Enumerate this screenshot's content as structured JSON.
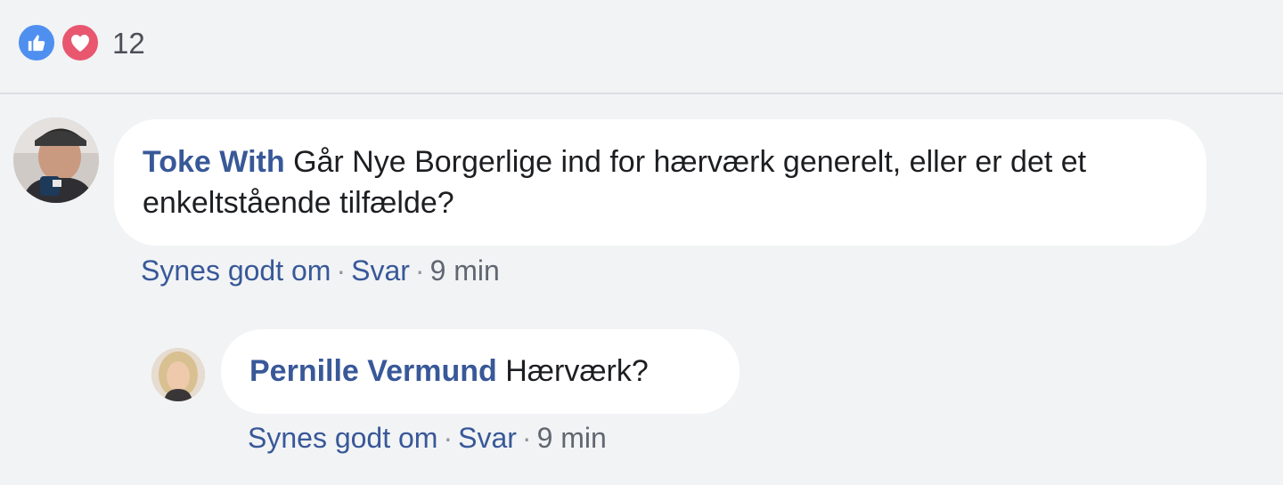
{
  "reactions": {
    "icons": [
      "like-icon",
      "love-icon"
    ],
    "count": "12"
  },
  "comments": [
    {
      "author": "Toke With",
      "text": "Går Nye Borgerlige ind for hærværk generelt, eller er det et enkeltstående tilfælde?",
      "actions": {
        "like": "Synes godt om",
        "reply": "Svar",
        "time": "9 min"
      }
    },
    {
      "author": "Pernille Vermund",
      "text": "Hærværk?",
      "actions": {
        "like": "Synes godt om",
        "reply": "Svar",
        "time": "9 min"
      }
    }
  ],
  "colors": {
    "background": "#f2f3f5",
    "link": "#385898",
    "like": "#4f8ff0",
    "love": "#e8576f"
  }
}
